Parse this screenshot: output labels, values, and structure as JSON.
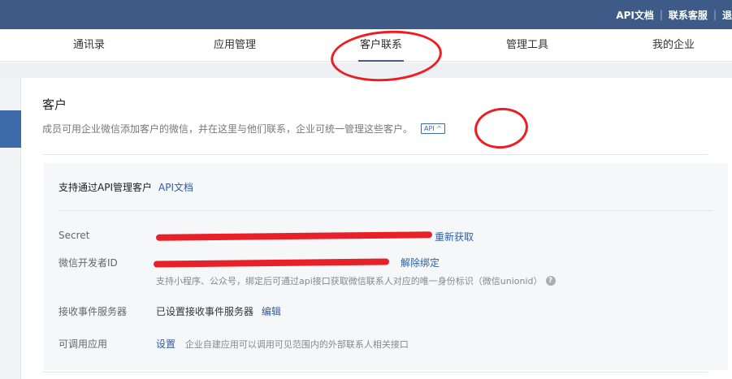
{
  "topbar": {
    "links": [
      "API文档",
      "联系客服",
      "退"
    ]
  },
  "nav": {
    "tabs": [
      "通讯录",
      "应用管理",
      "客户联系",
      "管理工具",
      "我的企业"
    ],
    "active": "客户联系"
  },
  "page": {
    "title": "客户",
    "description": "成员可用企业微信添加客户的微信，并在这里与他们联系，企业可统一管理这些客户。",
    "api_tag": "API ^"
  },
  "panel": {
    "header": "支持通过API管理客户",
    "header_link": "API文档",
    "rows": {
      "secret": {
        "label": "Secret",
        "link": "重新获取"
      },
      "developer_id": {
        "label": "微信开发者ID",
        "link": "解除绑定",
        "hint": "支持小程序、公众号，绑定后可通过api接口获取微信联系人对应的唯一身份标识（微信unionid）"
      },
      "event_server": {
        "label": "接收事件服务器",
        "value": "已设置接收事件服务器",
        "link": "编辑"
      },
      "apps": {
        "label": "可调用应用",
        "link": "设置",
        "hint": "企业自建应用可以调用可见范围内的外部联系人相关接口"
      }
    }
  },
  "colors": {
    "topbar": "#3d5b86",
    "link": "#2e5da4",
    "annotation": "#ec1e24"
  }
}
